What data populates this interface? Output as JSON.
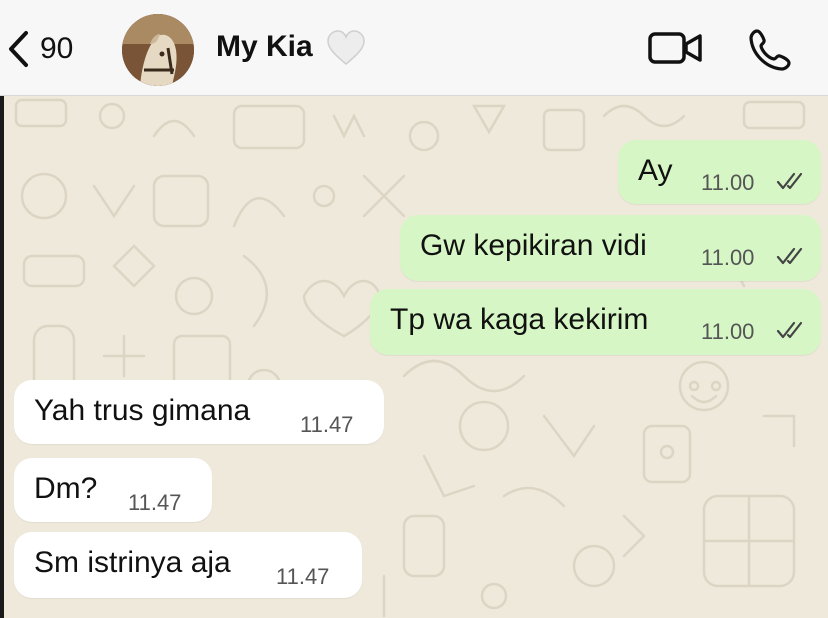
{
  "header": {
    "back_count": "90",
    "contact_name": "My Kia",
    "status_emoji_icon": "white-heart-icon",
    "actions": [
      "video-call-icon",
      "voice-call-icon"
    ]
  },
  "messages": [
    {
      "direction": "outgoing",
      "text": "Ay",
      "time": "11.00",
      "status": "read"
    },
    {
      "direction": "outgoing",
      "text": "Gw kepikiran vidi",
      "time": "11.00",
      "status": "read"
    },
    {
      "direction": "outgoing",
      "text": "Tp wa kaga kekirim",
      "time": "11.00",
      "status": "read"
    },
    {
      "direction": "incoming",
      "text": "Yah trus gimana",
      "time": "11.47"
    },
    {
      "direction": "incoming",
      "text": "Dm?",
      "time": "11.47"
    },
    {
      "direction": "incoming",
      "text": "Sm istrinya aja",
      "time": "11.47"
    }
  ],
  "colors": {
    "outgoing_bubble": "#d6f7c5",
    "incoming_bubble": "#ffffff",
    "chat_background": "#efe9dc",
    "header_background": "#f7f7f7"
  }
}
